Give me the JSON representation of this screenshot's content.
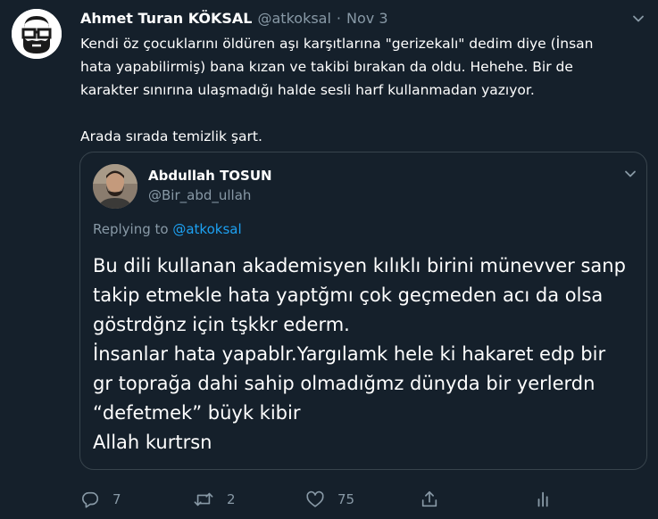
{
  "tweet": {
    "author_name": "Ahmet Turan KÖKSAL",
    "handle": "@atkoksal",
    "separator": "·",
    "date": "Nov 3",
    "text_paragraphs": [
      "Kendi öz çocuklarını öldüren aşı karşıtlarına \"gerizekalı\" dedim diye (İnsan\nhata yapabilirmiş) bana kızan ve takibi bırakan da oldu. Hehehe. Bir de\nkarakter sınırına ulaşmadığı halde sesli harf kullanmadan yazıyor.",
      "Arada sırada temizlik şart."
    ],
    "avatar_icon": "bearded-glasses-avatar-icon",
    "more_icon": "chevron-down-icon"
  },
  "quote": {
    "author_name": "Abdullah TOSUN",
    "handle": "@Bir_abd_ullah",
    "replying_prefix": "Replying to",
    "replying_mention": "@atkoksal",
    "text_lines": [
      "Bu dili kullanan akademisyen kılıklı birini münevver sanp",
      "takip etmekle hata yaptğmı çok geçmeden acı da olsa",
      "göstrdğnz için tşkkr ederm.",
      "İnsanlar hata yapablr.Yargılamk hele ki hakaret edp bir",
      "gr toprağa dahi sahip olmadığmz dünyda bir yerlerdn",
      "“defetmek” büyk kibir",
      "Allah kurtrsn"
    ]
  },
  "actions": {
    "reply_count": "7",
    "retweet_count": "2",
    "like_count": "75",
    "share_icon": "share-icon",
    "analytics_icon": "analytics-icon"
  },
  "colors": {
    "background": "#15202b",
    "text_primary": "#ffffff",
    "text_secondary": "#8899a6",
    "link": "#1da1f2",
    "border": "#38444d"
  }
}
